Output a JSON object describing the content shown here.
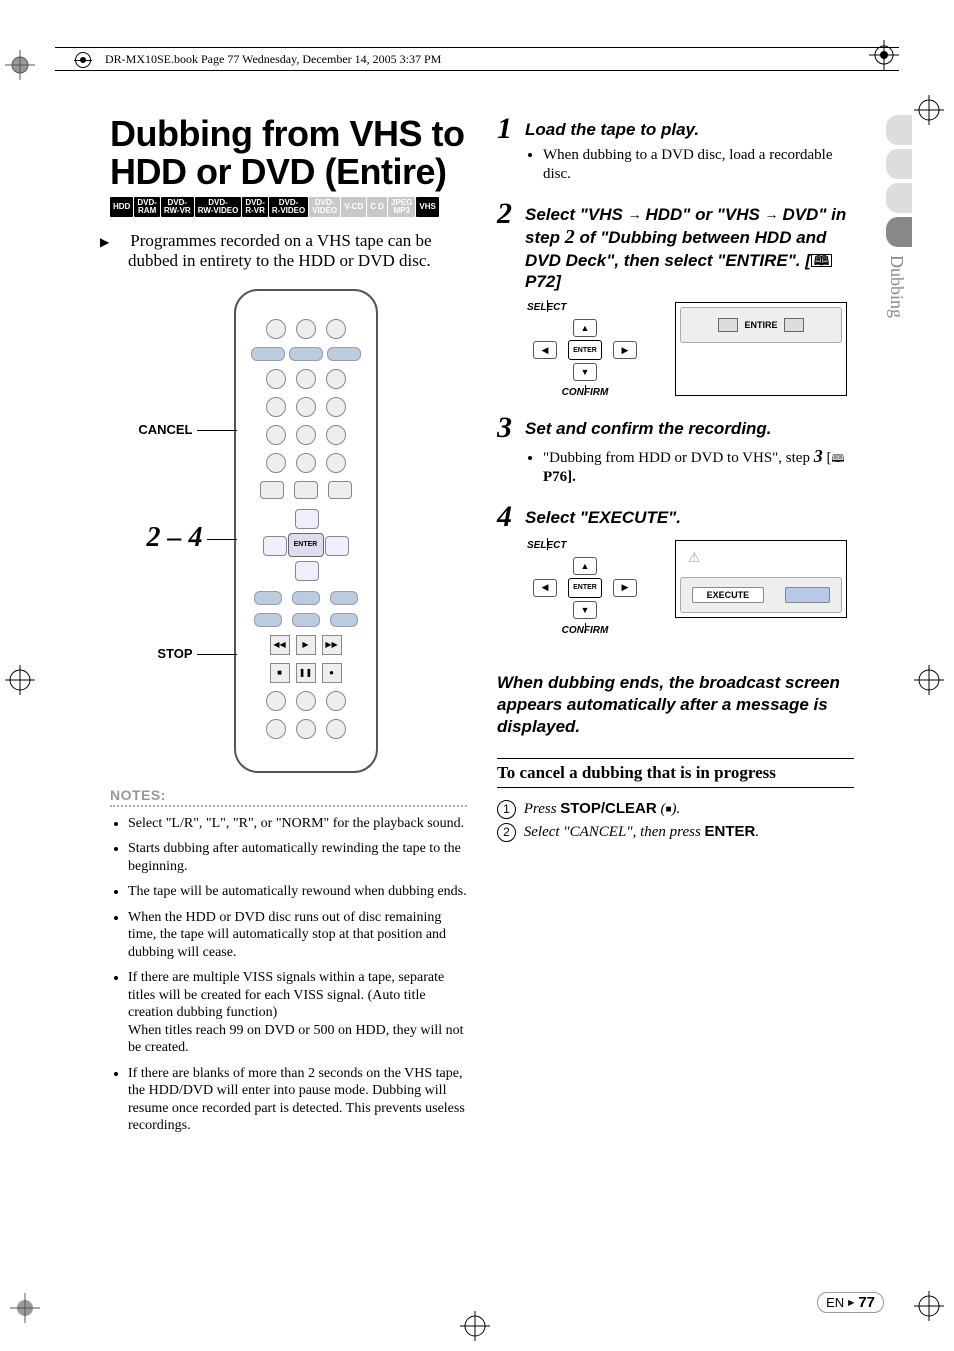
{
  "header": {
    "file_info": "DR-MX10SE.book  Page 77  Wednesday, December 14, 2005  3:37 PM"
  },
  "title": "Dubbing from VHS to HDD or DVD (Entire)",
  "badges": [
    {
      "text": "HDD",
      "grey": false
    },
    {
      "text": "DVD-\nRAM",
      "grey": false
    },
    {
      "text": "DVD-\nRW-VR",
      "grey": false
    },
    {
      "text": "DVD-\nRW-VIDEO",
      "grey": false
    },
    {
      "text": "DVD-\nR-VR",
      "grey": false
    },
    {
      "text": "DVD-\nR-VIDEO",
      "grey": false
    },
    {
      "text": "DVD-\nVIDEO",
      "grey": true
    },
    {
      "text": "V-CD",
      "grey": true
    },
    {
      "text": "C D",
      "grey": true
    },
    {
      "text": "JPEG\nMP3",
      "grey": true
    },
    {
      "text": "VHS",
      "grey": false
    }
  ],
  "intro": "Programmes recorded on a VHS tape can be dubbed in entirety to the HDD or DVD disc.",
  "remote_labels": {
    "cancel": "CANCEL",
    "range": "2 – 4",
    "stop": "STOP",
    "enter": "ENTER"
  },
  "notes_header": "NOTES:",
  "notes": [
    "Select \"L/R\", \"L\", \"R\", or \"NORM\" for the playback sound.",
    "Starts dubbing after automatically rewinding the tape to the beginning.",
    "The tape will be automatically rewound when dubbing ends.",
    "When the HDD or DVD disc runs out of disc remaining time, the tape will automatically stop at that position and dubbing will cease.",
    "If there are multiple VISS signals within a tape, separate titles will be created for each VISS signal. (Auto title creation dubbing function)\nWhen titles reach 99 on DVD or 500 on HDD, they will not be created.",
    "If there are blanks of more than 2 seconds on the VHS tape, the HDD/DVD will enter into pause mode. Dubbing will resume once recorded part is detected. This prevents useless recordings."
  ],
  "steps": {
    "s1": {
      "num": "1",
      "title": "Load the tape to play.",
      "bullet": "When dubbing to a DVD disc, load a recordable disc."
    },
    "s2": {
      "num": "2",
      "title_parts": {
        "a": "Select \"VHS",
        "b": "HDD\" or \"VHS",
        "c": "DVD\" in step",
        "d": "of \"Dubbing between HDD and DVD Deck\", then select \"ENTIRE\". [",
        "page": "P72]",
        "inline_num": "2"
      }
    },
    "s3": {
      "num": "3",
      "title": "Set and confirm the recording.",
      "bullet_a": "\"Dubbing from HDD or DVD to VHS\", step",
      "bullet_inline_num": "3",
      "bullet_b": "[",
      "bullet_page": "P76]."
    },
    "s4": {
      "num": "4",
      "title": "Select \"EXECUTE\"."
    }
  },
  "diagrams": {
    "select_label": "SELECT",
    "confirm_label": "CONFIRM",
    "enter": "ENTER",
    "entire": "ENTIRE",
    "execute": "EXECUTE"
  },
  "end_note": "When dubbing ends, the broadcast screen appears automatically after a message is displayed.",
  "cancel": {
    "heading": "To cancel a dubbing that is in progress",
    "step1_a": "Press ",
    "step1_b": "STOP/CLEAR",
    "step1_c": " (",
    "step1_d": ").",
    "step2_a": "Select \"CANCEL\", then press ",
    "step2_b": "ENTER",
    "step2_c": "."
  },
  "side_tab": "Dubbing",
  "footer": {
    "lang": "EN",
    "page": "77"
  }
}
